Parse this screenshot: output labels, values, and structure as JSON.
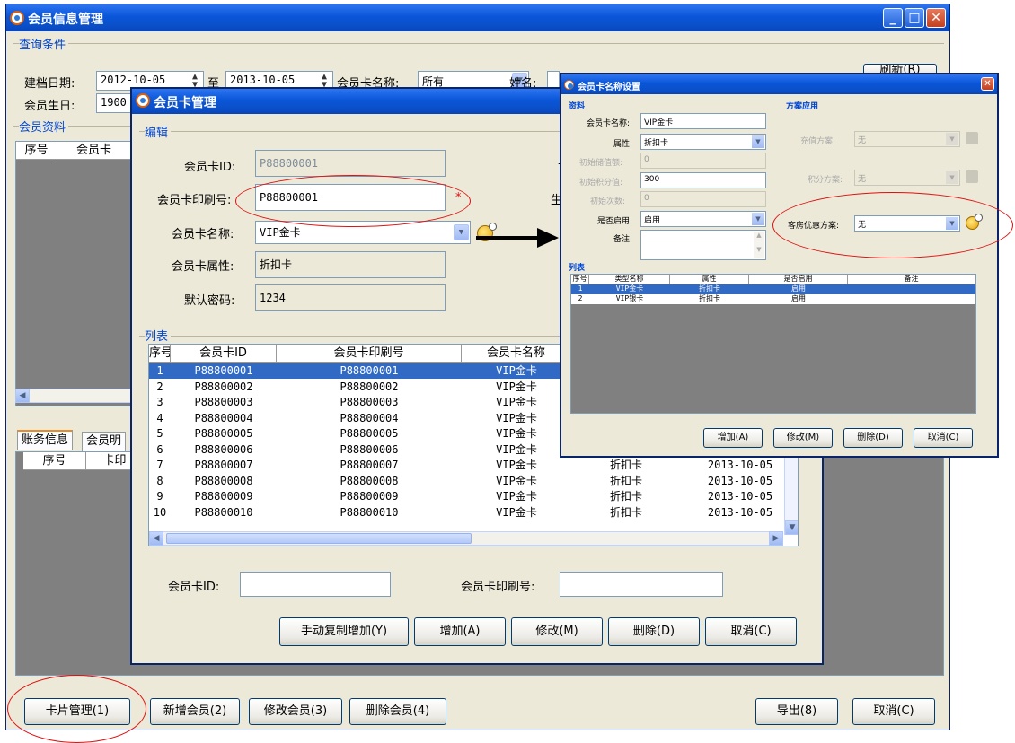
{
  "main": {
    "title": "会员信息管理",
    "query_section": "查询条件",
    "build_date_label": "建档日期:",
    "build_date_from": "2012-10-05",
    "to_label": "至",
    "build_date_to": "2013-10-05",
    "card_name_label": "会员卡名称:",
    "card_name_value": "所有",
    "name_label": "姓名:",
    "refresh_label": "刷新(R)",
    "birthday_label": "会员生日:",
    "birthday_value": "1900",
    "member_section": "会员资料",
    "member_cols": [
      "序号",
      "会员卡"
    ],
    "tabs": [
      "账务信息",
      "会员明"
    ],
    "account_cols": [
      "序号",
      "卡印"
    ],
    "buttons": {
      "card_mgmt": "卡片管理(1)",
      "add_member": "新增会员(2)",
      "edit_member": "修改会员(3)",
      "delete_member": "删除会员(4)",
      "export": "导出(8)",
      "cancel": "取消(C)"
    }
  },
  "card_dialog": {
    "title": "会员卡管理",
    "edit_section": "编辑",
    "card_id_label": "会员卡ID:",
    "card_id_value": "P88800001",
    "print_no_label": "会员卡印刷号:",
    "print_no_value": "P88800001",
    "required_mark": "*",
    "card_name_label": "会员卡名称:",
    "card_name_value": "VIP金卡",
    "attr_label": "会员卡属性:",
    "attr_value": "折扣卡",
    "pwd_label": "默认密码:",
    "pwd_value": "1234",
    "right_clip_1": "十",
    "right_clip_2": "生效",
    "list_section": "列表",
    "columns": [
      "序号",
      "会员卡ID",
      "会员卡印刷号",
      "会员卡名称",
      "",
      ""
    ],
    "rows": [
      {
        "no": "1",
        "id": "P88800001",
        "print": "P88800001",
        "name": "VIP金卡",
        "attr": "",
        "date": ""
      },
      {
        "no": "2",
        "id": "P88800002",
        "print": "P88800002",
        "name": "VIP金卡",
        "attr": "",
        "date": ""
      },
      {
        "no": "3",
        "id": "P88800003",
        "print": "P88800003",
        "name": "VIP金卡",
        "attr": "",
        "date": ""
      },
      {
        "no": "4",
        "id": "P88800004",
        "print": "P88800004",
        "name": "VIP金卡",
        "attr": "",
        "date": ""
      },
      {
        "no": "5",
        "id": "P88800005",
        "print": "P88800005",
        "name": "VIP金卡",
        "attr": "",
        "date": ""
      },
      {
        "no": "6",
        "id": "P88800006",
        "print": "P88800006",
        "name": "VIP金卡",
        "attr": "折扣卡",
        "date": "2013-10-05"
      },
      {
        "no": "7",
        "id": "P88800007",
        "print": "P88800007",
        "name": "VIP金卡",
        "attr": "折扣卡",
        "date": "2013-10-05"
      },
      {
        "no": "8",
        "id": "P88800008",
        "print": "P88800008",
        "name": "VIP金卡",
        "attr": "折扣卡",
        "date": "2013-10-05"
      },
      {
        "no": "9",
        "id": "P88800009",
        "print": "P88800009",
        "name": "VIP金卡",
        "attr": "折扣卡",
        "date": "2013-10-05"
      },
      {
        "no": "10",
        "id": "P88800010",
        "print": "P88800010",
        "name": "VIP金卡",
        "attr": "折扣卡",
        "date": "2013-10-05"
      }
    ],
    "search_id_label": "会员卡ID:",
    "search_print_label": "会员卡印刷号:",
    "buttons": {
      "copy_add": "手动复制增加(Y)",
      "add": "增加(A)",
      "edit": "修改(M)",
      "delete": "删除(D)",
      "cancel": "取消(C)"
    }
  },
  "settings_dialog": {
    "title": "会员卡名称设置",
    "data_section": "资料",
    "name_label": "会员卡名称:",
    "name_value": "VIP金卡",
    "attr_label": "属性:",
    "attr_value": "折扣卡",
    "init_store_label": "初始储值额:",
    "init_store_value": "0",
    "init_points_label": "初始积分值:",
    "init_points_value": "300",
    "init_count_label": "初始次数:",
    "init_count_value": "0",
    "enabled_label": "是否启用:",
    "enabled_value": "启用",
    "remark_label": "备注:",
    "plan_section": "方案应用",
    "recharge_label": "充值方案:",
    "recharge_value": "无",
    "points_plan_label": "积分方案:",
    "points_plan_value": "无",
    "room_plan_label": "客房优惠方案:",
    "room_plan_value": "无",
    "list_section": "列表",
    "columns": [
      "序号",
      "类型名称",
      "属性",
      "是否启用",
      "备注"
    ],
    "rows": [
      {
        "no": "1",
        "name": "VIP金卡",
        "attr": "折扣卡",
        "enabled": "启用"
      },
      {
        "no": "2",
        "name": "VIP银卡",
        "attr": "折扣卡",
        "enabled": "启用"
      }
    ],
    "buttons": {
      "add": "增加(A)",
      "edit": "修改(M)",
      "delete": "删除(D)",
      "cancel": "取消(C)"
    }
  },
  "colors": {
    "title_bar": "#0a56d8",
    "selection": "#316ac5",
    "section_text": "#0046d5",
    "annotation_red": "#e01010",
    "window_bg": "#ece9d8"
  }
}
